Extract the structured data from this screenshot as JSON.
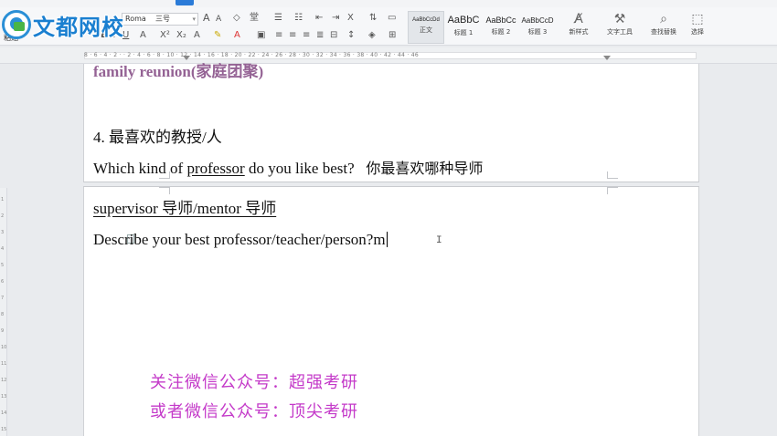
{
  "logo": {
    "text": "文都网校"
  },
  "ribbon": {
    "paste_label": "粘贴",
    "font_name": "Roma",
    "font_size": "三号",
    "font_grow": "A",
    "font_shrink": "A",
    "styles": [
      {
        "sample": "AaBbCcDd",
        "label": "正文"
      },
      {
        "sample": "AaBbC",
        "label": "标题 1"
      },
      {
        "sample": "AaBbCc",
        "label": "标题 2"
      },
      {
        "sample": "AaBbCcD",
        "label": "标题 3"
      }
    ],
    "new_style_label": "新样式",
    "text_tools_label": "文字工具",
    "find_replace_label": "查找替换",
    "select_label": "选择"
  },
  "ruler": {
    "marks": "8 · 6 · 4 · 2 · · 2 · 4 · 6 · 8 · 10 · 12 · 14 · 16 · 18 · 20 · 22 · 24 · 26 · 28 · 30 · 32 · 34 · 36 · 38 · 40 · 42 · 44 · 46"
  },
  "vruler": {
    "marks": [
      "1",
      "2",
      "3",
      "4",
      "5",
      "6",
      "7",
      "8",
      "9",
      "10",
      "11",
      "12",
      "13",
      "14",
      "15"
    ]
  },
  "document": {
    "cut_line": "family reunion(家庭团聚)",
    "heading": "4. 最喜欢的教授/人",
    "question_prefix": "Which kind of ",
    "question_underlined": "professor",
    "question_suffix": " do you like best?",
    "question_cn": "你最喜欢哪种导师",
    "supervisor_line": "supervisor  导师/mentor    导师",
    "describe_line": "Describe your best professor/teacher/person?m"
  },
  "promo": {
    "line1": "关注微信公众号：超强考研",
    "line2": "或者微信公众号：顶尖考研"
  },
  "colors": {
    "promo": "#c43ac9",
    "logo_blue": "#1a7fd0",
    "tab_active": "#2b7bd8"
  }
}
